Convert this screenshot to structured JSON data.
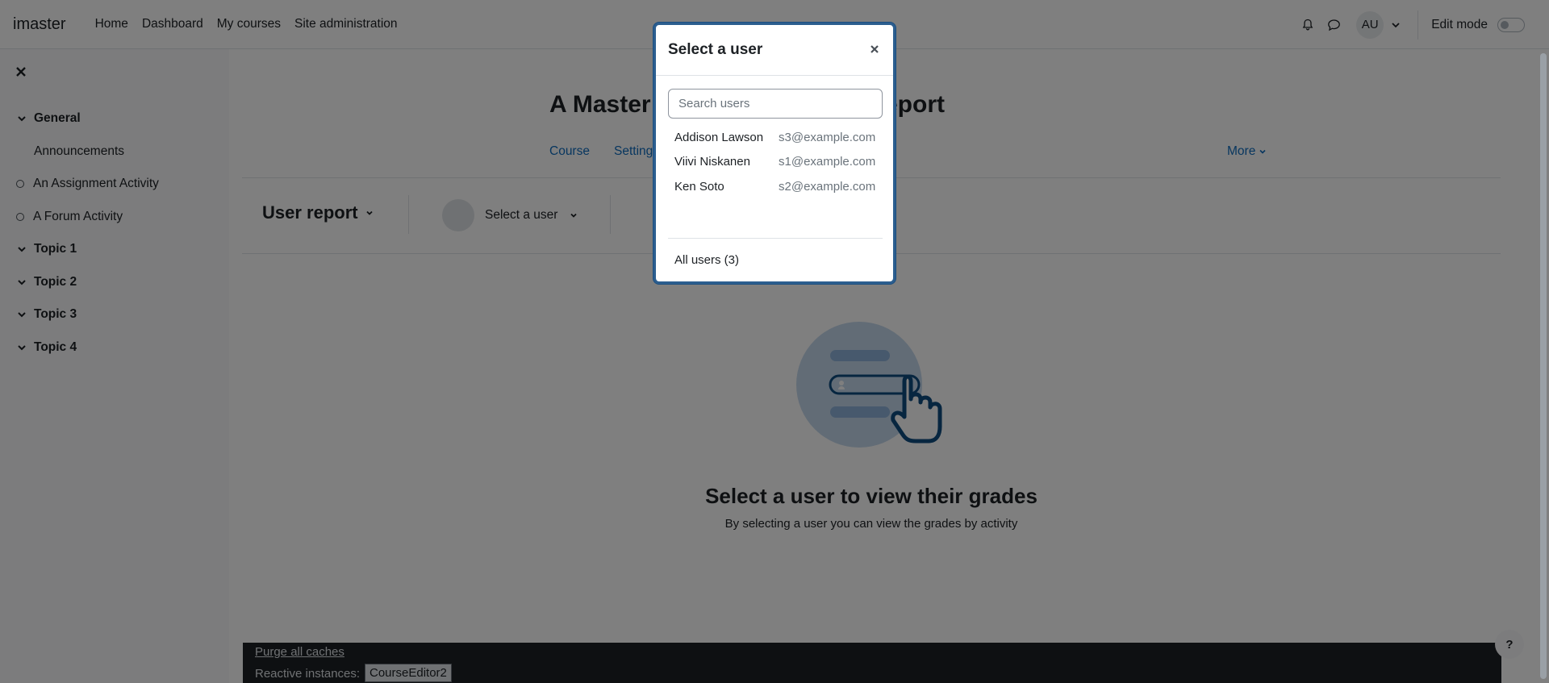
{
  "navbar": {
    "brand": "imaster",
    "items": [
      "Home",
      "Dashboard",
      "My courses",
      "Site administration"
    ],
    "avatar_initials": "AU",
    "edit_mode_label": "Edit mode"
  },
  "drawer": {
    "course_index": [
      {
        "type": "section",
        "label": "General"
      },
      {
        "type": "page",
        "label": "Announcements"
      },
      {
        "type": "activity",
        "label": "An Assignment Activity"
      },
      {
        "type": "activity",
        "label": "A Forum Activity"
      },
      {
        "type": "section",
        "label": "Topic 1"
      },
      {
        "type": "section",
        "label": "Topic 2"
      },
      {
        "type": "section",
        "label": "Topic 3"
      },
      {
        "type": "section",
        "label": "Topic 4"
      }
    ]
  },
  "main": {
    "page_title_left": "A Master",
    "page_title_right": "eport",
    "secondary_nav": {
      "course": "Course",
      "settings": "Settings",
      "more": "More"
    },
    "report_selector": "User report",
    "user_selector": "Select a user",
    "empty_title": "Select a user to view their grades",
    "empty_subtitle": "By selecting a user you can view the grades by activity"
  },
  "footer": {
    "purge_link": "Purge all caches",
    "reactive_label": "Reactive instances:",
    "reactive_button": "CourseEditor2",
    "help_label": "?"
  },
  "modal": {
    "title": "Select a user",
    "search_placeholder": "Search users",
    "users": [
      {
        "name": "Addison Lawson",
        "email": "s3@example.com"
      },
      {
        "name": "Viivi Niskanen",
        "email": "s1@example.com"
      },
      {
        "name": "Ken Soto",
        "email": "s2@example.com"
      }
    ],
    "all_users": "All users (3)"
  },
  "colors": {
    "link": "#0f6cbf",
    "illustration_light": "#c5d8ec",
    "illustration_dark": "#0f4c81"
  }
}
